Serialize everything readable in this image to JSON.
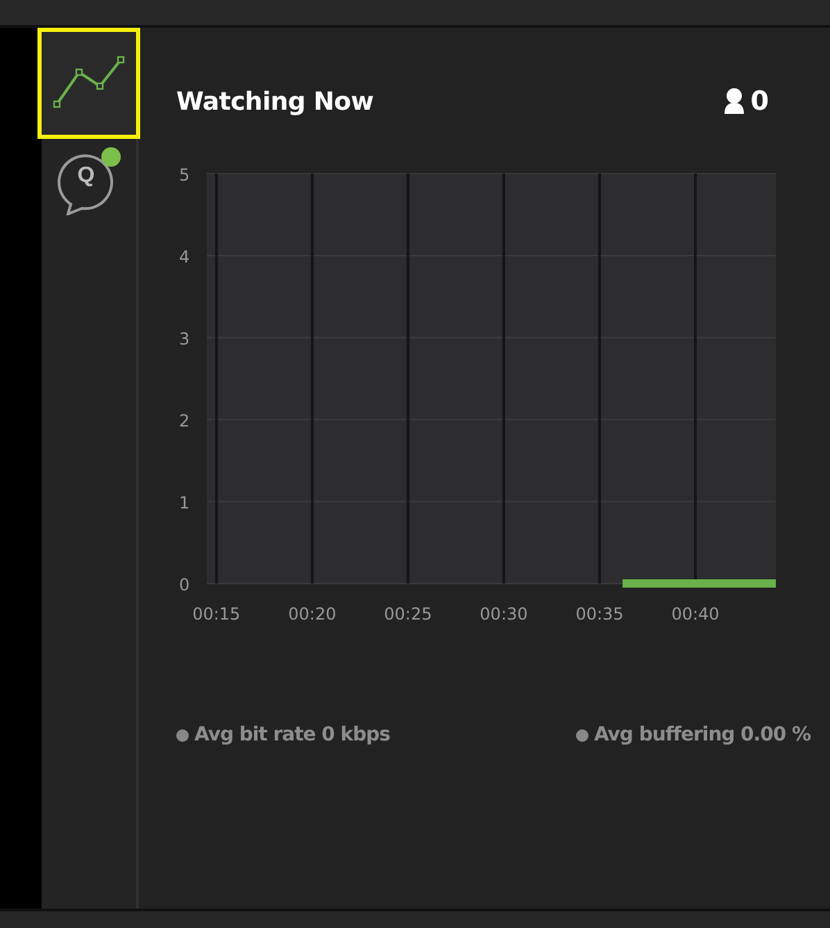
{
  "sidebar": {
    "items": [
      {
        "kind": "chart",
        "selected": true,
        "notification": false
      },
      {
        "kind": "chat",
        "selected": false,
        "notification": true,
        "glyph": "Q"
      }
    ]
  },
  "panel": {
    "title": "Watching Now",
    "viewers": "0",
    "chart_data": {
      "type": "line",
      "x": [
        36.2,
        44.2
      ],
      "grid": true,
      "series": [
        {
          "color": "#6ab04c",
          "values": [
            0,
            0
          ]
        }
      ],
      "xlim": [
        14.5,
        44.2
      ],
      "ylim": [
        0,
        5
      ],
      "xticks": [
        {
          "value": 15,
          "label": "00:15"
        },
        {
          "value": 20,
          "label": "00:20"
        },
        {
          "value": 25,
          "label": "00:25"
        },
        {
          "value": 30,
          "label": "00:30"
        },
        {
          "value": 35,
          "label": "00:35"
        },
        {
          "value": 40,
          "label": "00:40"
        }
      ],
      "yticks": [
        0,
        1,
        2,
        3,
        4,
        5
      ]
    },
    "legend": [
      {
        "label": "Avg bit rate 0 kbps"
      },
      {
        "label": "Avg buffering 0.00 %"
      }
    ]
  }
}
